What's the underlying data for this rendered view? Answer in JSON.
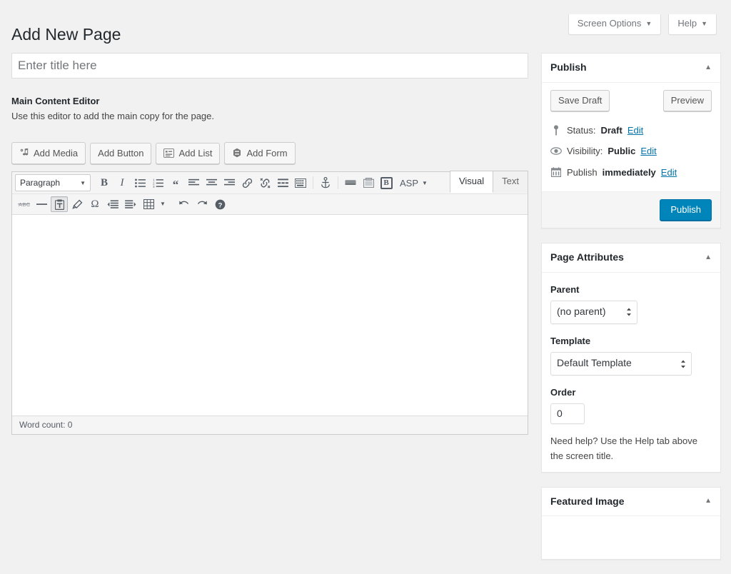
{
  "screen_meta": {
    "screen_options_label": "Screen Options",
    "help_label": "Help",
    "caret": "▼"
  },
  "page_title": "Add New Page",
  "title_field": {
    "value": "",
    "placeholder": "Enter title here"
  },
  "editor_meta": {
    "label": "Main Content Editor",
    "description": "Use this editor to add the main copy for the page."
  },
  "media_buttons": [
    {
      "label": "Add Media",
      "icon": "media-icon"
    },
    {
      "label": "Add Button",
      "icon": "none"
    },
    {
      "label": "Add List",
      "icon": "list-icon"
    },
    {
      "label": "Add Form",
      "icon": "form-icon"
    }
  ],
  "editor_tabs": [
    {
      "label": "Visual",
      "active": true
    },
    {
      "label": "Text",
      "active": false
    }
  ],
  "toolbar": {
    "format_select": "Paragraph",
    "format_caret": "▼",
    "asp_label": "ASP",
    "asp_caret": "▼",
    "bootstrap_badge": "B",
    "row1_icons": [
      "bold-icon",
      "italic-icon",
      "bulleted-list-icon",
      "numbered-list-icon",
      "blockquote-icon",
      "align-left-icon",
      "align-center-icon",
      "align-right-icon",
      "insert-link-icon",
      "remove-link-icon",
      "read-more-icon",
      "keyboard-icon",
      "anchor-icon",
      "button-shortcode-icon",
      "gallery-icon"
    ],
    "row2_icons": [
      "strikethrough-icon",
      "horizontal-rule-icon",
      "paste-as-text-icon",
      "clear-formatting-icon",
      "special-character-icon",
      "decrease-indent-icon",
      "increase-indent-icon",
      "table-icon",
      "table-caret-icon",
      "undo-icon",
      "redo-icon",
      "keyboard-shortcuts-icon"
    ],
    "fullscreen_icon": "distraction-free-icon",
    "table_caret": "▼"
  },
  "statusbar": {
    "word_count": "Word count: 0"
  },
  "publish_panel": {
    "title": "Publish",
    "toggle_icon": "▲",
    "save_draft_label": "Save Draft",
    "preview_label": "Preview",
    "status": {
      "icon": "pin-icon",
      "prefix": "Status:",
      "value": "Draft",
      "edit_label": "Edit"
    },
    "visibility": {
      "icon": "eye-icon",
      "prefix": "Visibility:",
      "value": "Public",
      "edit_label": "Edit"
    },
    "schedule": {
      "icon": "calendar-icon",
      "prefix": "Publish",
      "value": "immediately",
      "edit_label": "Edit"
    },
    "publish_label": "Publish"
  },
  "page_attributes_panel": {
    "title": "Page Attributes",
    "toggle_icon": "▲",
    "parent_label": "Parent",
    "parent_value": "(no parent)",
    "template_label": "Template",
    "template_value": "Default Template",
    "order_label": "Order",
    "order_value": "0",
    "help_text": "Need help? Use the Help tab above the screen title."
  },
  "featured_image_panel": {
    "title": "Featured Image",
    "toggle_icon": "▲"
  },
  "colors": {
    "accent": "#0085ba",
    "link": "#0073aa",
    "page_bg": "#f1f1f1",
    "panel_border": "#e5e5e5"
  }
}
